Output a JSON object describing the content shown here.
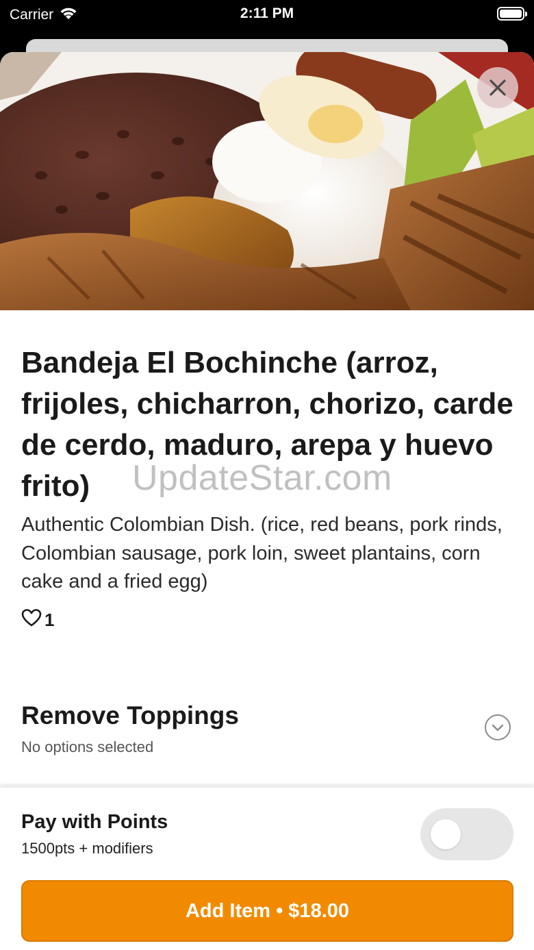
{
  "status_bar": {
    "carrier": "Carrier",
    "time": "2:11 PM",
    "battery_level": 1.0
  },
  "item": {
    "title": "Bandeja El Bochinche (arroz, frijoles, chicharron, chorizo, carde de cerdo, maduro, arepa y huevo frito)",
    "description": "Authentic Colombian Dish. (rice, red beans, pork rinds, Colombian sausage, pork loin, sweet plantains, corn cake and a fried egg)",
    "likes_count": "1",
    "watermark": "UpdateStar.com"
  },
  "options": {
    "title": "Remove Toppings",
    "subtitle": "No options selected"
  },
  "points": {
    "title": "Pay with Points",
    "subtitle": "1500pts + modifiers",
    "enabled": false
  },
  "action": {
    "add_label": "Add Item • $18.00"
  },
  "colors": {
    "accent": "#f28a00",
    "toggle_off": "#e6e6e6"
  },
  "icons": {
    "close": "close-icon",
    "heart": "heart-icon",
    "chevron": "chevron-down-icon",
    "wifi": "wifi-icon"
  }
}
